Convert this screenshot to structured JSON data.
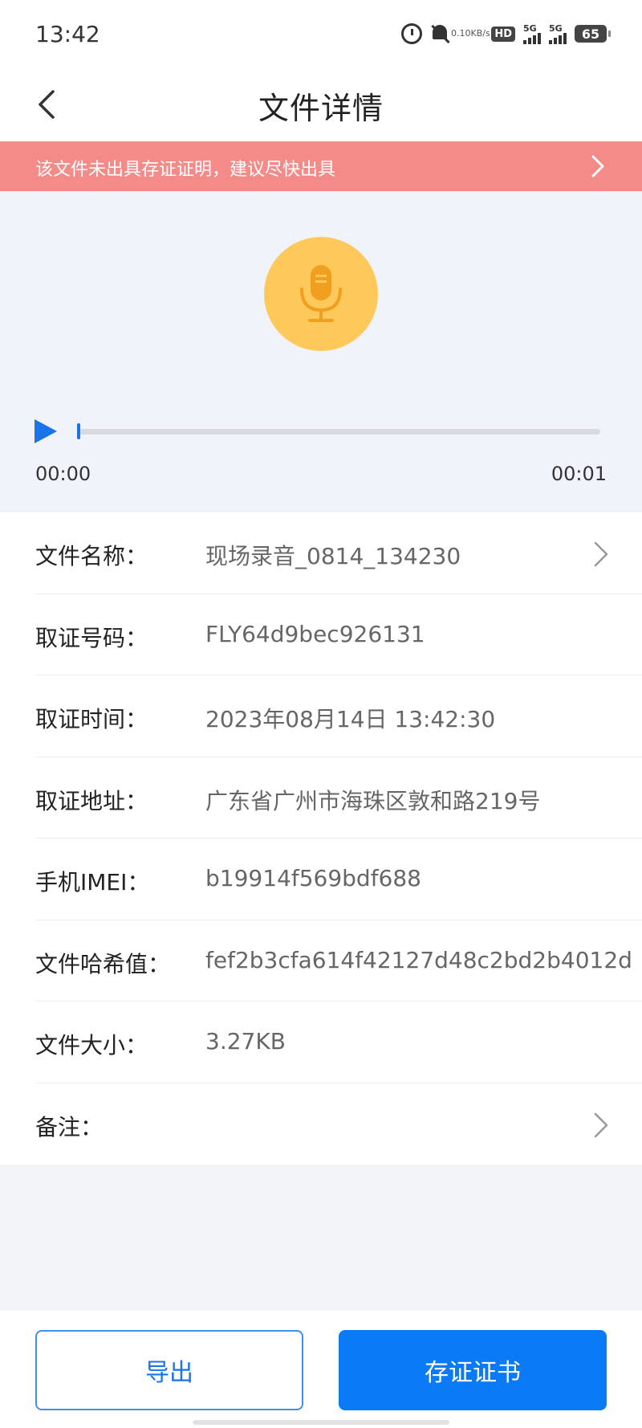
{
  "status_bar": {
    "time": "13:42",
    "net_speed_value": "0.10",
    "net_speed_unit": "KB/s",
    "hd_label": "HD",
    "signal_1_label": "5G",
    "signal_2_label": "5G",
    "battery_level": "65",
    "icons": [
      "alarm-icon",
      "bell-muted-icon",
      "hd-icon",
      "signal-icon",
      "signal-icon",
      "battery-icon"
    ]
  },
  "header": {
    "title": "文件详情",
    "back_icon": "chevron-left-icon"
  },
  "banner": {
    "text": "该文件未出具存证证明，建议尽快出具",
    "color": "#f58b88",
    "icon": "chevron-right-icon"
  },
  "player": {
    "current_time": "00:00",
    "total_time": "00:01",
    "progress": 0,
    "mic_circle_color": "#ffc85a",
    "accent": "#1a73e8"
  },
  "details": {
    "rows": [
      {
        "label": "文件名称：",
        "value": "现场录音_0814_134230",
        "has_chevron": true
      },
      {
        "label": "取证号码：",
        "value": "FLY64d9bec926131",
        "has_chevron": false
      },
      {
        "label": "取证时间：",
        "value": "2023年08月14日 13:42:30",
        "has_chevron": false
      },
      {
        "label": "取证地址：",
        "value": "广东省广州市海珠区敦和路219号",
        "has_chevron": false
      },
      {
        "label": "手机IMEI：",
        "value": "b19914f569bdf688",
        "has_chevron": false
      },
      {
        "label": "文件哈希值：",
        "value": "fef2b3cfa614f42127d48c2bd2b4012d",
        "has_chevron": false
      },
      {
        "label": "文件大小：",
        "value": "3.27KB",
        "has_chevron": false
      },
      {
        "label": "备注：",
        "value": "",
        "has_chevron": true
      }
    ]
  },
  "actions": {
    "export_label": "导出",
    "certificate_label": "存证证书",
    "primary_color": "#0a7af6"
  }
}
